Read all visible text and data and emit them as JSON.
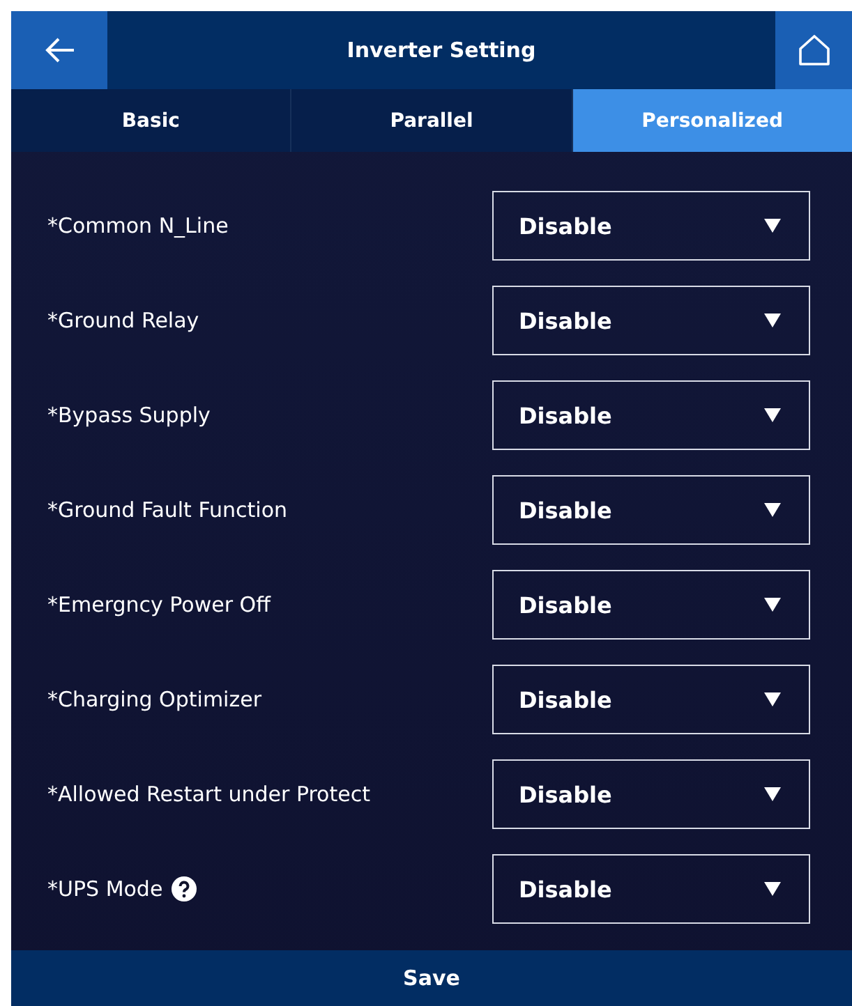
{
  "header": {
    "title": "Inverter Setting"
  },
  "tabs": [
    {
      "label": "Basic",
      "selected": false
    },
    {
      "label": "Parallel",
      "selected": false
    },
    {
      "label": "Personalized",
      "selected": true
    }
  ],
  "settings": [
    {
      "label": "*Common N_Line",
      "value": "Disable",
      "help": false
    },
    {
      "label": "*Ground Relay",
      "value": "Disable",
      "help": false
    },
    {
      "label": "*Bypass Supply",
      "value": "Disable",
      "help": false
    },
    {
      "label": "*Ground Fault Function",
      "value": "Disable",
      "help": false
    },
    {
      "label": "*Emergncy Power Off",
      "value": "Disable",
      "help": false
    },
    {
      "label": "*Charging Optimizer",
      "value": "Disable",
      "help": false
    },
    {
      "label": "*Allowed Restart under Protect",
      "value": "Disable",
      "help": false
    },
    {
      "label": "*UPS Mode",
      "value": "Disable",
      "help": true
    }
  ],
  "save_button": "Save"
}
